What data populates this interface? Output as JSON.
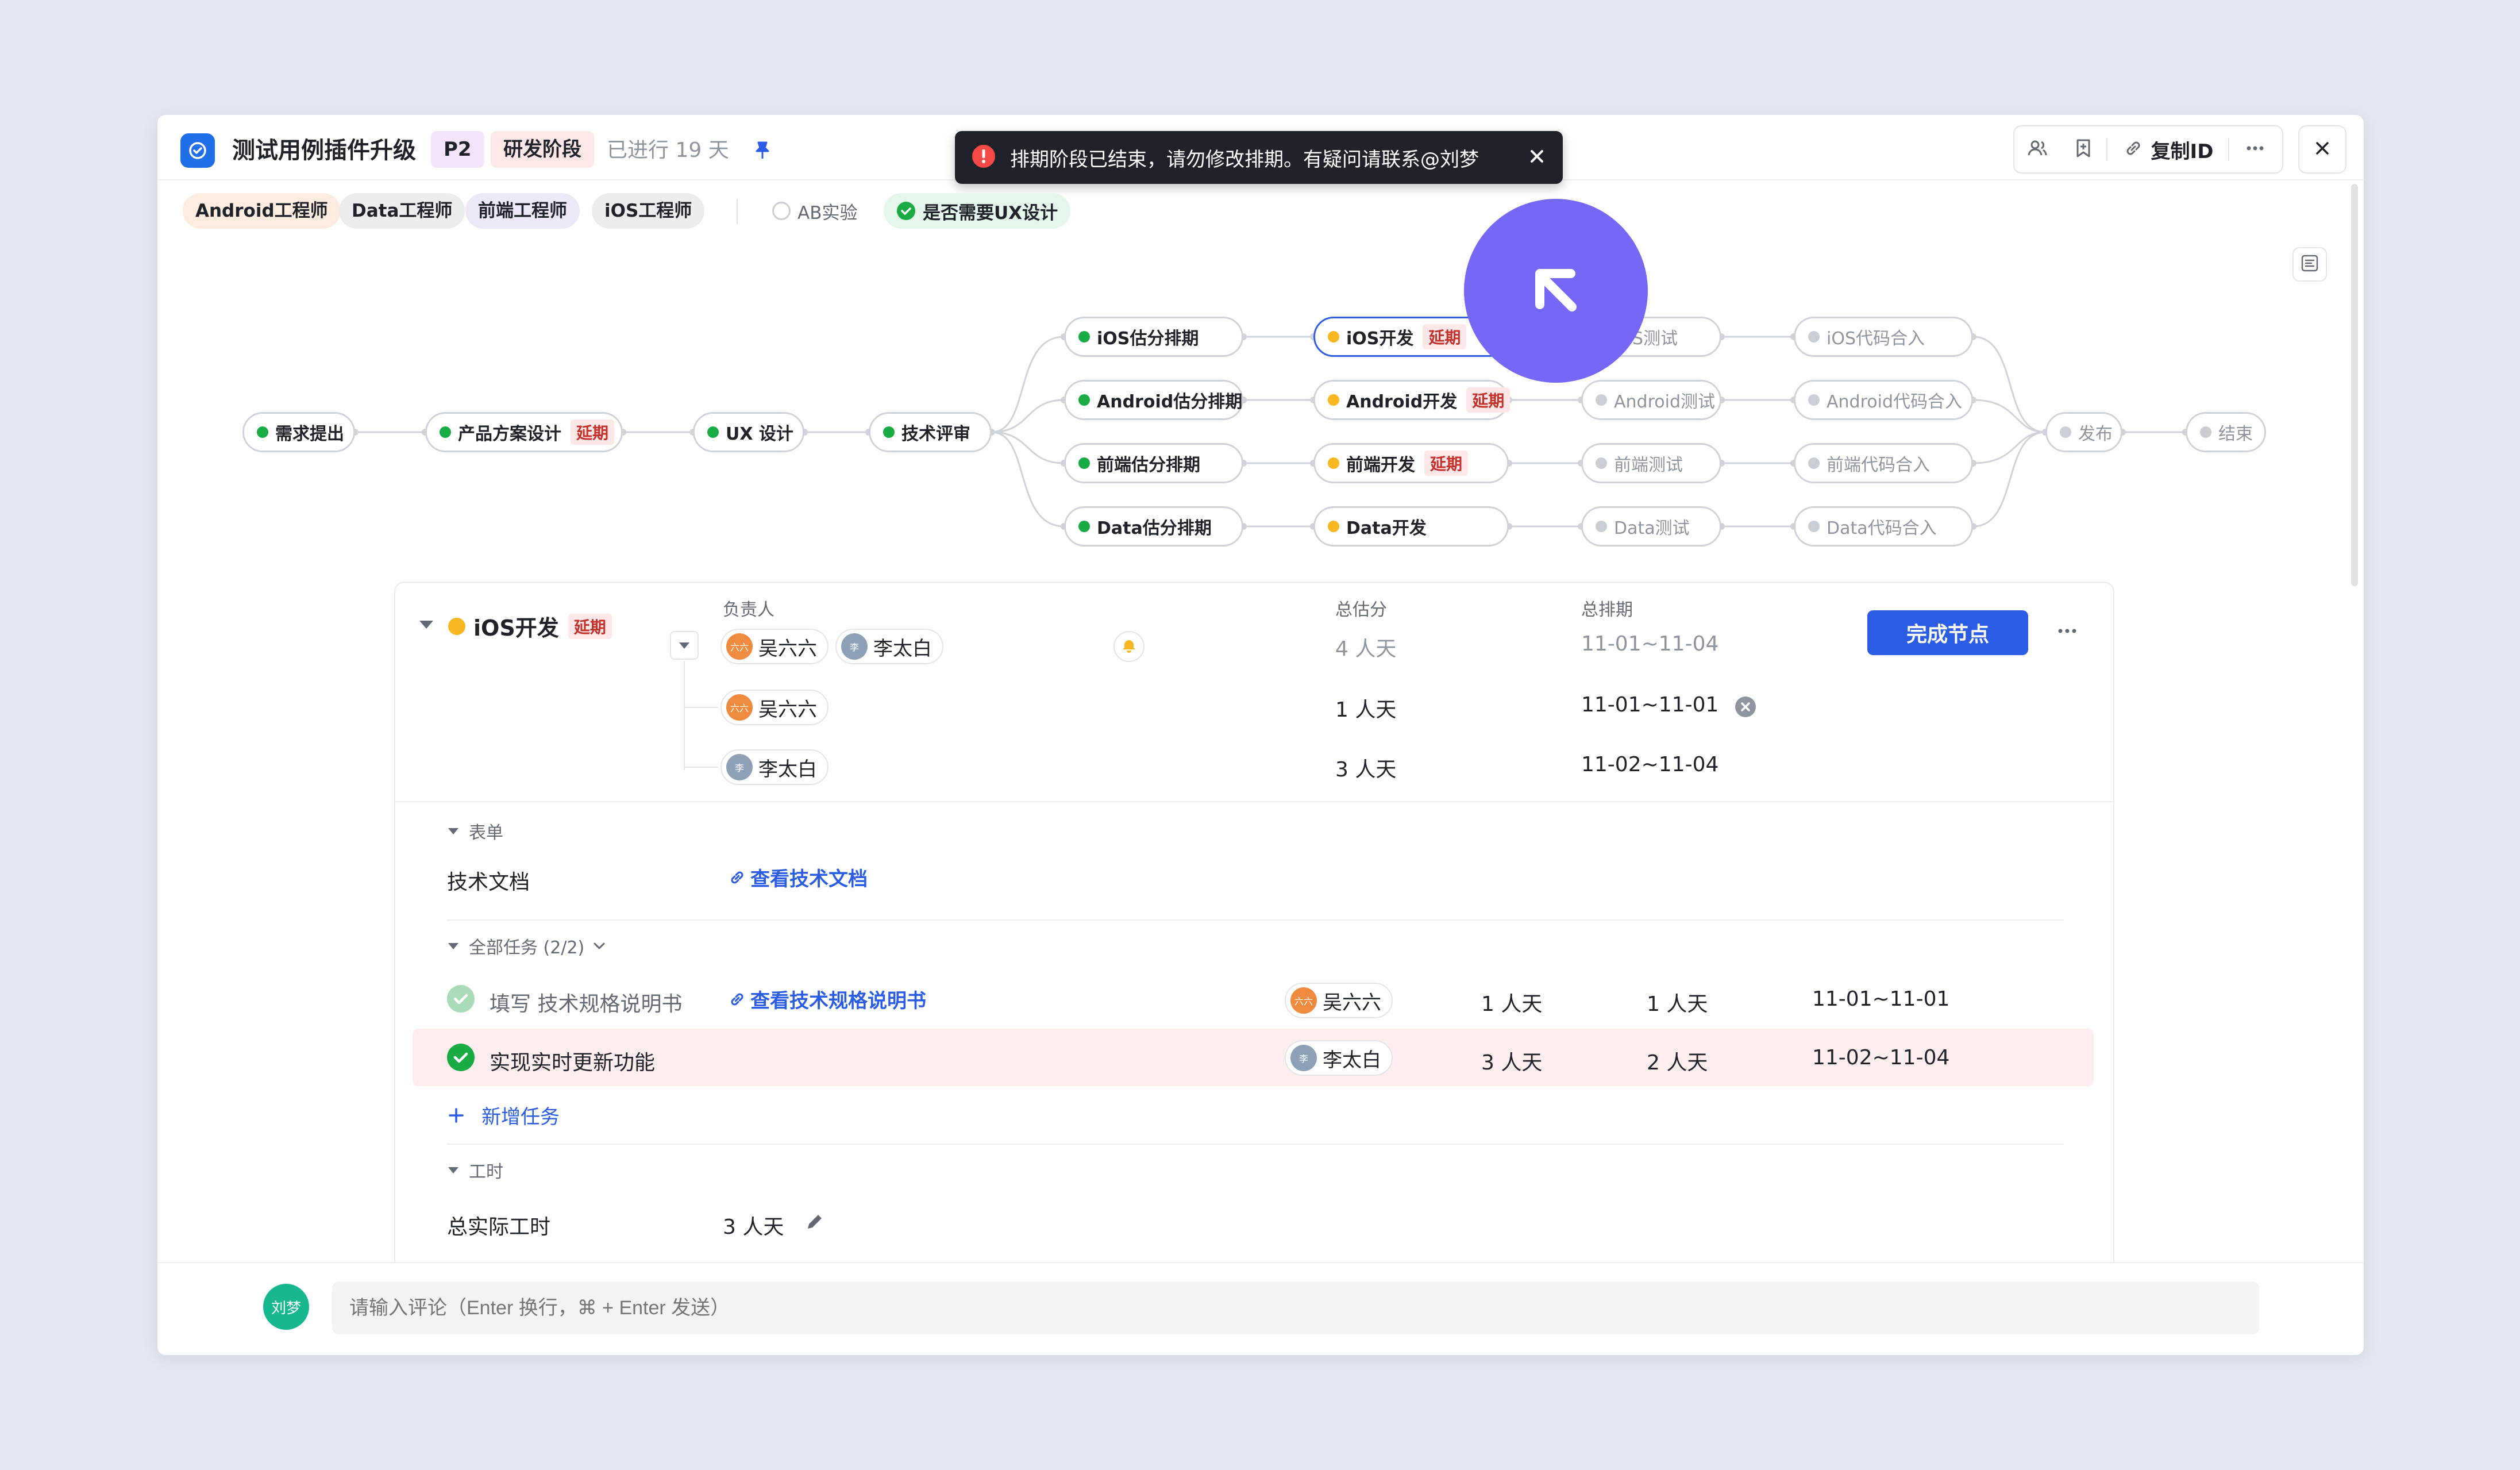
{
  "header": {
    "title": "测试用例插件升级",
    "priority": "P2",
    "stage": "研发阶段",
    "elapsed": "已进行 19 天",
    "copy_id_label": "复制ID"
  },
  "toast": {
    "message": "排期阶段已结束，请勿修改排期。有疑问请联系@刘梦"
  },
  "roles": [
    "Android工程师",
    "Data工程师",
    "前端工程师",
    "iOS工程师"
  ],
  "flags": {
    "ab_label": "AB实验",
    "ab_checked": false,
    "ux_label": "是否需要UX设计",
    "ux_checked": true
  },
  "flow": {
    "delay_tag": "延期",
    "nodes": {
      "req": "需求提出",
      "design": "产品方案设计",
      "ux": "UX 设计",
      "review": "技术评审",
      "ios_est": "iOS估分排期",
      "android_est": "Android估分排期",
      "fe_est": "前端估分排期",
      "data_est": "Data估分排期",
      "ios_dev": "iOS开发",
      "android_dev": "Android开发",
      "fe_dev": "前端开发",
      "data_dev": "Data开发",
      "ios_test": "iOS测试",
      "android_test": "Android测试",
      "fe_test": "前端测试",
      "data_test": "Data测试",
      "ios_merge": "iOS代码合入",
      "android_merge": "Android代码合入",
      "fe_merge": "前端代码合入",
      "data_merge": "Data代码合入",
      "release": "发布",
      "end": "结束"
    }
  },
  "detail": {
    "node_name": "iOS开发",
    "delay_tag": "延期",
    "owner_label": "负责人",
    "estimate_label": "总估分",
    "schedule_label": "总排期",
    "complete_button": "完成节点",
    "rows": [
      {
        "estimate": "4 人天",
        "schedule": "11-01~11-04"
      },
      {
        "owner": "吴六六",
        "estimate": "1 人天",
        "schedule": "11-01~11-01"
      },
      {
        "owner": "李太白",
        "estimate": "3 人天",
        "schedule": "11-02~11-04"
      }
    ],
    "owners": [
      "吴六六",
      "李太白"
    ],
    "form_section": "表单",
    "tech_doc_label": "技术文档",
    "tech_doc_link": "查看技术文档",
    "tasks_section": "全部任务 (2/2)",
    "tasks": [
      {
        "title": "填写 技术规格说明书",
        "link": "查看技术规格说明书",
        "owner": "吴六六",
        "estimate": "1 人天",
        "actual": "1 人天",
        "schedule": "11-01~11-01"
      },
      {
        "title": "实现实时更新功能",
        "link": "",
        "owner": "李太白",
        "estimate": "3 人天",
        "actual": "2 人天",
        "schedule": "11-02~11-04"
      }
    ],
    "add_task": "新增任务",
    "hours_section": "工时",
    "total_hours_label": "总实际工时",
    "total_hours_value": "3 人天"
  },
  "comment": {
    "user": "刘梦",
    "placeholder": "请输入评论（Enter 换行，⌘ + Enter 发送）"
  },
  "colors": {
    "primary": "#2b5ce6",
    "done": "#1aab45",
    "in_progress": "#f7b720",
    "pending": "#c9cdd4",
    "delay": "#c4302b",
    "cursor": "#7568f6"
  }
}
